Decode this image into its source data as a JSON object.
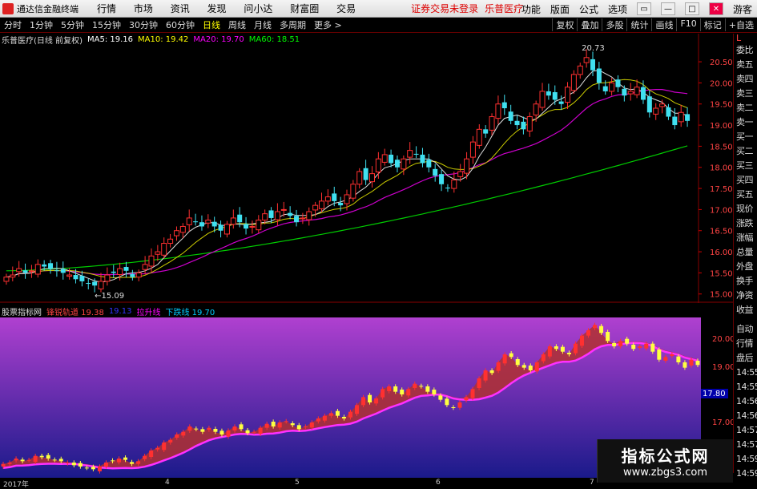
{
  "titlebar": {
    "app_name": "通达信金融终端",
    "menu": [
      "行情",
      "市场",
      "资讯",
      "发现",
      "问小达",
      "财富圈",
      "交易"
    ],
    "alert": "证券交易未登录",
    "stock_name": "乐普医疗",
    "right_menu": [
      "功能",
      "版面",
      "公式",
      "选项"
    ],
    "guest": "游客"
  },
  "toolbar": {
    "tabs": [
      "分时",
      "1分钟",
      "5分钟",
      "15分钟",
      "30分钟",
      "60分钟",
      "日线",
      "周线",
      "月线",
      "多周期",
      "更多 >"
    ],
    "active_tab": "日线",
    "right_tools": [
      "复权",
      "叠加",
      "多股",
      "统计",
      "画线",
      "F10",
      "标记",
      "+自选"
    ]
  },
  "main_legend": {
    "title": "乐普医疗(日线 前复权)",
    "ma5": "MA5: 19.16",
    "ma10": "MA10: 19.42",
    "ma20": "MA20: 19.70",
    "ma60": "MA60: 18.51",
    "colors": {
      "ma5": "#ffffff",
      "ma10": "#ffff00",
      "ma20": "#ff00ff",
      "ma60": "#00ff00"
    }
  },
  "main_axis": {
    "ticks": [
      "20.50",
      "20.00",
      "19.50",
      "19.00",
      "18.50",
      "18.00",
      "17.50",
      "17.00",
      "16.50",
      "16.00",
      "15.50",
      "15.00"
    ],
    "high_label": "20.73",
    "low_label": "15.09"
  },
  "sub_legend": {
    "title": "股票指标网",
    "line1": "锋锐轨道 19.38",
    "line2": "19.13",
    "line3": "拉升线",
    "line4": "下跌线 19.70"
  },
  "sub_axis": {
    "ticks": [
      "20.00",
      "19.00",
      "17.00"
    ],
    "marker": "17.80"
  },
  "right_panel": {
    "top": [
      "L",
      "委比",
      "卖五",
      "卖四",
      "卖三",
      "卖二",
      "卖一",
      "买一",
      "买二",
      "买三",
      "买四",
      "买五",
      "现价",
      "涨跌",
      "涨幅",
      "总量",
      "外盘",
      "换手",
      "净资",
      "收益"
    ],
    "bottom": [
      "自动",
      "行情",
      "盘后",
      "14:55",
      "14:55",
      "14:56",
      "14:56",
      "14:57",
      "14:57",
      "14:59",
      "14:59"
    ]
  },
  "datebar": {
    "labels": [
      "2017年",
      "4",
      "5",
      "6",
      "7"
    ]
  },
  "watermark": {
    "title": "指标公式网",
    "url": "www.zbgs3.com"
  },
  "chart_data": {
    "type": "candlestick",
    "title": "乐普医疗(日线 前复权)",
    "ylim": [
      14.9,
      20.9
    ],
    "closes": [
      15.4,
      15.45,
      15.6,
      15.5,
      15.55,
      15.7,
      15.65,
      15.6,
      15.55,
      15.5,
      15.45,
      15.35,
      15.3,
      15.25,
      15.2,
      15.3,
      15.45,
      15.5,
      15.6,
      15.55,
      15.4,
      15.5,
      15.7,
      15.9,
      16.0,
      16.2,
      16.3,
      16.5,
      16.6,
      16.8,
      16.7,
      16.6,
      16.75,
      16.6,
      16.5,
      16.65,
      16.8,
      16.7,
      16.55,
      16.6,
      16.75,
      16.9,
      16.8,
      16.95,
      17.0,
      16.85,
      16.7,
      16.8,
      16.95,
      17.1,
      17.2,
      17.3,
      17.2,
      17.1,
      17.35,
      17.6,
      17.9,
      17.7,
      17.85,
      18.2,
      18.3,
      18.1,
      18.0,
      18.2,
      18.4,
      18.3,
      18.1,
      18.0,
      17.8,
      17.6,
      17.5,
      17.7,
      17.9,
      18.2,
      18.6,
      18.9,
      18.8,
      19.2,
      19.5,
      19.4,
      19.1,
      19.0,
      18.9,
      19.2,
      19.5,
      19.8,
      19.7,
      19.6,
      19.5,
      19.9,
      20.2,
      20.4,
      20.6,
      20.3,
      20.0,
      19.8,
      20.0,
      19.9,
      19.7,
      19.8,
      19.9,
      19.6,
      19.3,
      19.4,
      19.5,
      19.2,
      19.0,
      19.3,
      19.1
    ],
    "ma60_start": 15.55,
    "ma60_end": 18.51
  }
}
